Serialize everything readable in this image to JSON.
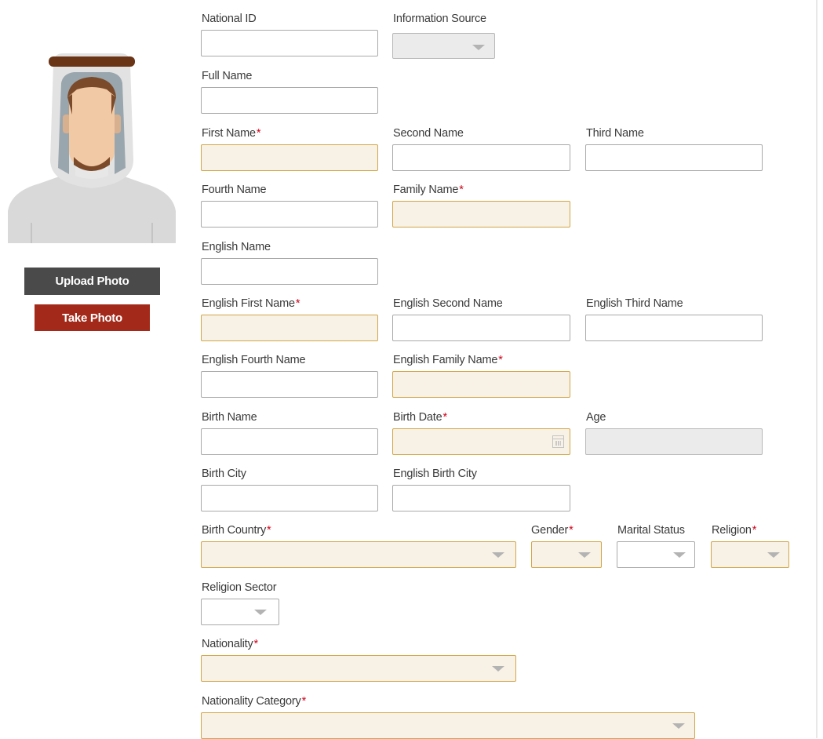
{
  "photo": {
    "upload_label": "Upload Photo",
    "take_label": "Take Photo",
    "colors": {
      "upload": "#4a4a4a",
      "take": "#a32a1a"
    }
  },
  "form": {
    "national_id": {
      "label": "National ID",
      "value": ""
    },
    "information_source": {
      "label": "Information Source",
      "value": ""
    },
    "full_name": {
      "label": "Full Name",
      "value": ""
    },
    "first_name": {
      "label": "First Name",
      "required_mark": "*",
      "value": ""
    },
    "second_name": {
      "label": "Second Name",
      "value": ""
    },
    "third_name": {
      "label": "Third Name",
      "value": ""
    },
    "fourth_name": {
      "label": "Fourth Name",
      "value": ""
    },
    "family_name": {
      "label": "Family Name",
      "required_mark": "*",
      "value": ""
    },
    "english_name": {
      "label": "English Name",
      "value": ""
    },
    "english_first_name": {
      "label": "English First Name",
      "required_mark": "*",
      "value": ""
    },
    "english_second_name": {
      "label": "English Second Name",
      "value": ""
    },
    "english_third_name": {
      "label": "English Third Name",
      "value": ""
    },
    "english_fourth_name": {
      "label": "English Fourth Name",
      "value": ""
    },
    "english_family_name": {
      "label": "English Family Name",
      "required_mark": "*",
      "value": ""
    },
    "birth_name": {
      "label": "Birth Name",
      "value": ""
    },
    "birth_date": {
      "label": "Birth Date",
      "required_mark": "*",
      "value": ""
    },
    "age": {
      "label": "Age",
      "value": ""
    },
    "birth_city": {
      "label": "Birth City",
      "value": ""
    },
    "english_birth_city": {
      "label": "English Birth City",
      "value": ""
    },
    "birth_country": {
      "label": "Birth Country",
      "required_mark": "*",
      "value": ""
    },
    "gender": {
      "label": "Gender",
      "required_mark": "*",
      "value": ""
    },
    "marital_status": {
      "label": "Marital Status",
      "value": ""
    },
    "religion": {
      "label": "Religion",
      "required_mark": "*",
      "value": ""
    },
    "religion_sector": {
      "label": "Religion Sector",
      "value": ""
    },
    "nationality": {
      "label": "Nationality",
      "required_mark": "*",
      "value": ""
    },
    "nationality_category": {
      "label": "Nationality Category",
      "required_mark": "*",
      "value": ""
    }
  },
  "colors": {
    "required_fill": "#f8f2e6",
    "required_border": "#d2a547",
    "disabled_fill": "#ebebeb",
    "asterisk": "#d0021b"
  },
  "icons": {
    "dropdown": "chevron-down-icon",
    "calendar": "calendar-icon"
  }
}
